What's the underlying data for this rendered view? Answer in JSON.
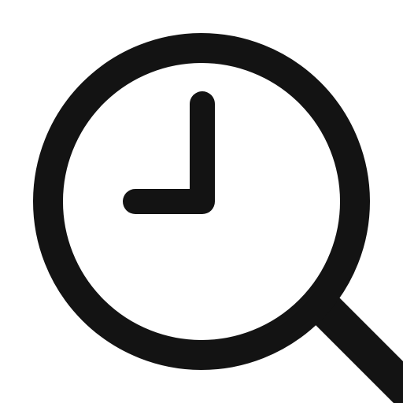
{
  "icon": {
    "name": "search-history-icon",
    "parts": [
      "magnifier-lens",
      "magnifier-handle",
      "clock-hands"
    ],
    "foreground_color": "#131313",
    "background_color": "#ffffff"
  }
}
